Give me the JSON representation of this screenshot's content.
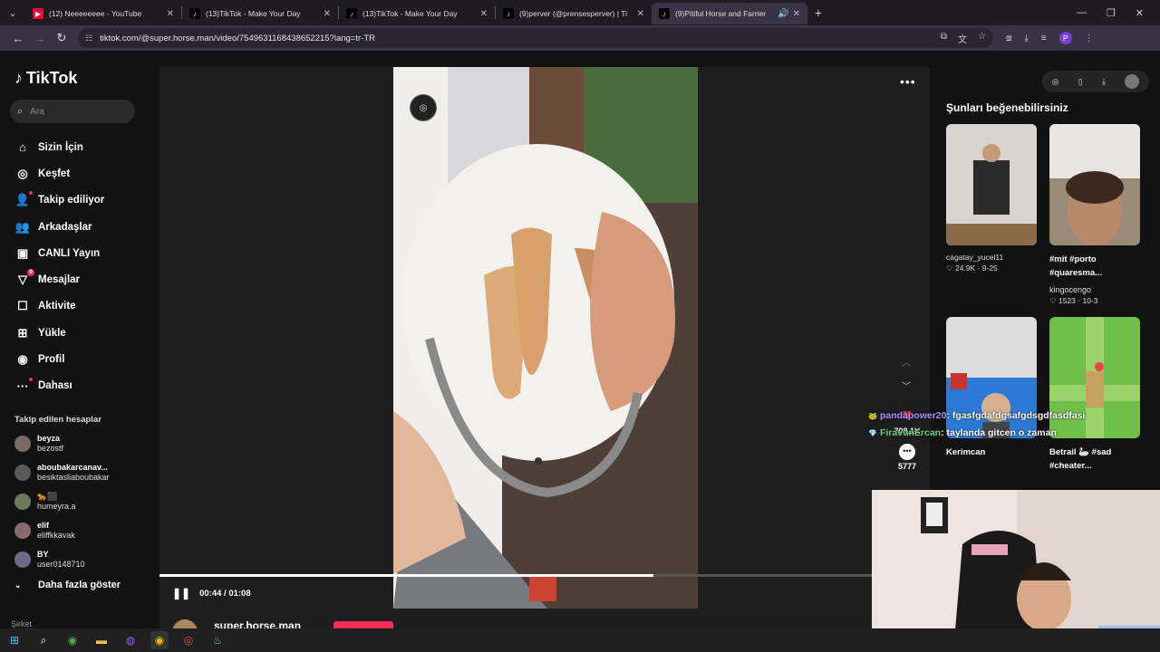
{
  "browser": {
    "tabs": [
      {
        "title": "(12) Neeeeeeee - YouTube",
        "icon": "youtube",
        "color": "#ff0033"
      },
      {
        "title": "(13)TikTok - Make Your Day",
        "icon": "tiktok"
      },
      {
        "title": "(13)TikTok - Make Your Day",
        "icon": "tiktok"
      },
      {
        "title": "(9)perver (@prensesperver) | Ti",
        "icon": "tiktok"
      },
      {
        "title": "(9)Pitiful Horse and Farrier",
        "icon": "tiktok",
        "active": true
      }
    ],
    "url": "tiktok.com/@super.horse.man/video/7549631168438652215?lang=tr-TR",
    "profile_initial": "P"
  },
  "sidebar": {
    "logo": "TikTok",
    "search_placeholder": "Ara",
    "nav": [
      {
        "label": "Sizin İçin",
        "icon": "home-icon"
      },
      {
        "label": "Keşfet",
        "icon": "compass-icon"
      },
      {
        "label": "Takip ediliyor",
        "icon": "user-follow-icon"
      },
      {
        "label": "Arkadaşlar",
        "icon": "friends-icon"
      },
      {
        "label": "CANLI Yayın",
        "icon": "live-icon"
      },
      {
        "label": "Mesajlar",
        "icon": "messages-icon",
        "badge": "9"
      },
      {
        "label": "Aktivite",
        "icon": "activity-icon"
      },
      {
        "label": "Yükle",
        "icon": "upload-icon"
      },
      {
        "label": "Profil",
        "icon": "profile-icon"
      },
      {
        "label": "Dahası",
        "icon": "more-icon"
      }
    ],
    "following_title": "Takip edilen hesaplar",
    "following": [
      {
        "name": "beyza",
        "handle": "bezostf"
      },
      {
        "name": "aboubakarcanav...",
        "handle": "besiktasliaboubakar"
      },
      {
        "name": "🐆⬛",
        "handle": "humeyra.a"
      },
      {
        "name": "elif",
        "handle": "eliffkkavak"
      },
      {
        "name": "BY",
        "handle": "user0148710"
      }
    ],
    "show_more": "Daha fazla göster",
    "company": "Şirket"
  },
  "video": {
    "time": "00:44 / 01:08",
    "progress": 0.69,
    "likes": "708.1K",
    "comments": "5777",
    "author": "super.horse.man"
  },
  "recommendations": {
    "title": "Şunları beğenebilirsiniz",
    "cards": [
      {
        "caption": "",
        "user": "cagatay_yucel11",
        "likes": "24.9K",
        "date": "9-25"
      },
      {
        "caption": "#mit #porto\n#quaresma...",
        "user": "kingocengo",
        "likes": "1523",
        "date": "10-3"
      },
      {
        "caption": "Kerimcan",
        "user": "",
        "likes": "",
        "date": ""
      },
      {
        "caption": "Betrail 🦢 #sad\n#cheater...",
        "user": "",
        "likes": "",
        "date": ""
      }
    ]
  },
  "chat": [
    {
      "user": "pandapower20",
      "message": "fgasfgdafdgsafgdsgdfasdfasi"
    },
    {
      "user": "FiravunErcan",
      "message": "taylanda gitcen o zaman"
    }
  ]
}
